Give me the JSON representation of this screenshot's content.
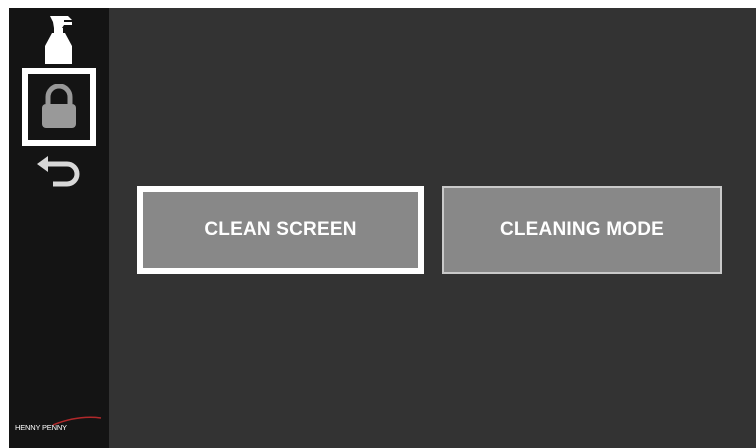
{
  "sidebar": {
    "icons": [
      {
        "name": "spray-bottle-icon"
      },
      {
        "name": "lock-icon",
        "selected": true
      },
      {
        "name": "back-arrow-icon"
      }
    ],
    "logo_text": "HENNY PENNY"
  },
  "main": {
    "buttons": [
      {
        "label": "CLEAN SCREEN",
        "selected": true
      },
      {
        "label": "CLEANING MODE",
        "selected": false
      }
    ]
  },
  "colors": {
    "background": "#333333",
    "sidebar": "#141414",
    "button": "#888888",
    "highlight": "#ffffff",
    "logo_accent": "#b0282a"
  }
}
